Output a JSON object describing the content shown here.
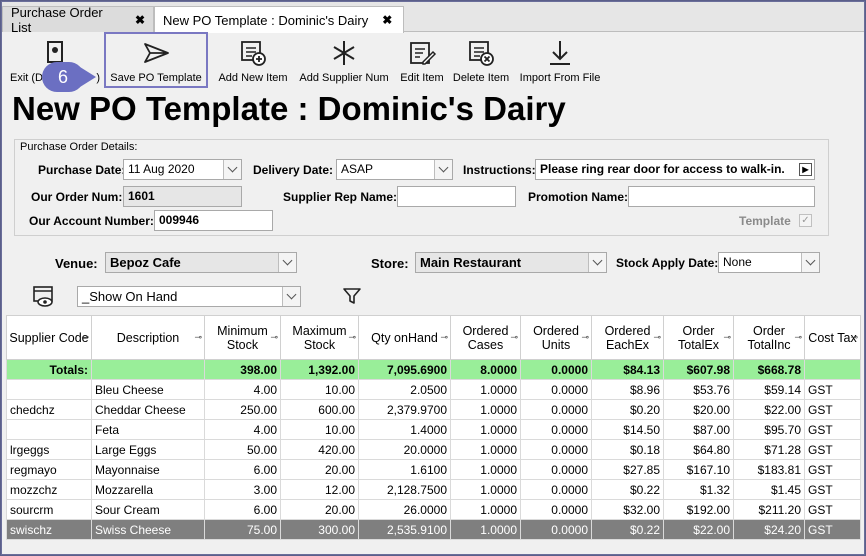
{
  "tabs": [
    {
      "label": "Purchase Order List"
    },
    {
      "label": "New PO Template : Dominic's Dairy"
    }
  ],
  "toolbar": {
    "exit": "Exit (Discard)",
    "exit_short": "Exit (D",
    "exit_tail": ")",
    "save": "Save PO Template",
    "add_item": "Add New Item",
    "add_supplier_num": "Add Supplier Num",
    "edit_item": "Edit Item",
    "delete_item": "Delete Item",
    "import": "Import From File"
  },
  "callout": "6",
  "page_title": "New PO Template : Dominic's Dairy",
  "details": {
    "group_label": "Purchase Order Details:",
    "purchase_date_label": "Purchase Date:",
    "purchase_date": "11 Aug 2020",
    "delivery_date_label": "Delivery Date:",
    "delivery_date": "ASAP",
    "instructions_label": "Instructions:",
    "instructions": "Please ring rear door for access to walk-in.",
    "order_num_label": "Our Order Num:",
    "order_num": "1601",
    "supplier_rep_label": "Supplier Rep Name:",
    "supplier_rep": "",
    "promotion_label": "Promotion Name:",
    "promotion": "",
    "account_label": "Our Account Number:",
    "account": "009946",
    "template_label": "Template",
    "template_check": "✓"
  },
  "filters": {
    "venue_label": "Venue:",
    "venue": "Bepoz Cafe",
    "store_label": "Store:",
    "store": "Main Restaurant",
    "stock_apply_label": "Stock Apply Date:",
    "stock_apply": "None",
    "view": "_Show On Hand"
  },
  "table": {
    "headers": [
      "Supplier Code",
      "Description",
      "Minimum Stock",
      "Maximum Stock",
      "Qty onHand",
      "Ordered Cases",
      "Ordered Units",
      "Ordered EachEx",
      "Order TotalEx",
      "Order TotalInc",
      "Cost Tax"
    ],
    "totals": [
      "Totals:",
      "",
      "398.00",
      "1,392.00",
      "7,095.6900",
      "8.0000",
      "0.0000",
      "$84.13",
      "$607.98",
      "$668.78",
      ""
    ],
    "rows": [
      [
        "",
        "Bleu Cheese",
        "4.00",
        "10.00",
        "2.0500",
        "1.0000",
        "0.0000",
        "$8.96",
        "$53.76",
        "$59.14",
        "GST"
      ],
      [
        "chedchz",
        "Cheddar Cheese",
        "250.00",
        "600.00",
        "2,379.9700",
        "1.0000",
        "0.0000",
        "$0.20",
        "$20.00",
        "$22.00",
        "GST"
      ],
      [
        "",
        "Feta",
        "4.00",
        "10.00",
        "1.4000",
        "1.0000",
        "0.0000",
        "$14.50",
        "$87.00",
        "$95.70",
        "GST"
      ],
      [
        "lrgeggs",
        "Large Eggs",
        "50.00",
        "420.00",
        "20.0000",
        "1.0000",
        "0.0000",
        "$0.18",
        "$64.80",
        "$71.28",
        "GST"
      ],
      [
        "regmayo",
        "Mayonnaise",
        "6.00",
        "20.00",
        "1.6100",
        "1.0000",
        "0.0000",
        "$27.85",
        "$167.10",
        "$183.81",
        "GST"
      ],
      [
        "mozzchz",
        "Mozzarella",
        "3.00",
        "12.00",
        "2,128.7500",
        "1.0000",
        "0.0000",
        "$0.22",
        "$1.32",
        "$1.45",
        "GST"
      ],
      [
        "sourcrm",
        "Sour Cream",
        "6.00",
        "20.00",
        "26.0000",
        "1.0000",
        "0.0000",
        "$32.00",
        "$192.00",
        "$211.20",
        "GST"
      ],
      [
        "swischz",
        "Swiss Cheese",
        "75.00",
        "300.00",
        "2,535.9100",
        "1.0000",
        "0.0000",
        "$0.22",
        "$22.00",
        "$24.20",
        "GST"
      ]
    ]
  }
}
